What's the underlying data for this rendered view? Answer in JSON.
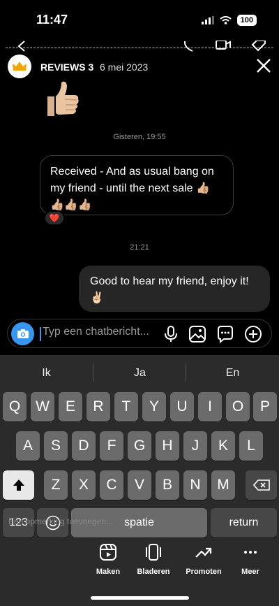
{
  "status_bar": {
    "time": "11:47",
    "battery": "100"
  },
  "header": {
    "name": "REVIEWS 3",
    "date": "6 mei 2023"
  },
  "timestamps": [
    "Gisteren, 19:55",
    "21:21"
  ],
  "messages": {
    "incoming": "Received - And as usual bang on my friend - until the next sale 👍🏼 👍🏼👍🏼👍🏼",
    "reaction": "❤️",
    "outgoing": "Good to hear my friend, enjoy it! ✌🏻"
  },
  "composer": {
    "placeholder": "Typ een chatbericht..."
  },
  "keyboard": {
    "suggestions": [
      "Ik",
      "Ja",
      "En"
    ],
    "row1": [
      "Q",
      "W",
      "E",
      "R",
      "T",
      "Y",
      "U",
      "I",
      "O",
      "P"
    ],
    "row2": [
      "A",
      "S",
      "D",
      "F",
      "G",
      "H",
      "J",
      "K",
      "L"
    ],
    "row3": [
      "Z",
      "X",
      "C",
      "V",
      "B",
      "N",
      "M"
    ],
    "numbers_key": "123",
    "space_key": "spatie",
    "return_key": "return",
    "ghost_text": "Een opmerking toevoegen..."
  },
  "bottom_tabs": [
    {
      "label": "Maken",
      "icon": "reel-icon"
    },
    {
      "label": "Bladeren",
      "icon": "cards-icon"
    },
    {
      "label": "Promoten",
      "icon": "trend-icon"
    },
    {
      "label": "Meer",
      "icon": "more-icon"
    }
  ],
  "colors": {
    "accent": "#3797f0",
    "outgoing_bubble": "#262626",
    "keyboard_bg": "#2b2b2b"
  }
}
